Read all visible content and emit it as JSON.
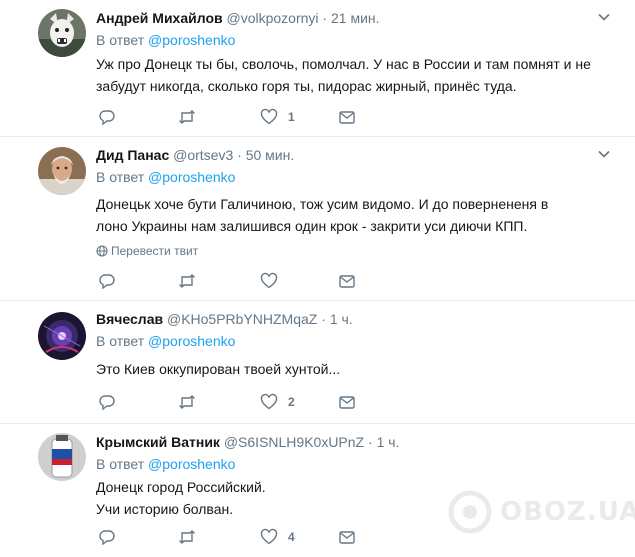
{
  "reply_prefix": "В ответ",
  "tweets": [
    {
      "name": "Андрей Михайлов",
      "handle": "@volkpozornyi",
      "separator": "·",
      "time": "21 мин.",
      "reply_to": "@poroshenko",
      "lines": [
        "Уж про Донецк ты бы, сволочь, помолчал. У нас в России и там помнят и не",
        "забудут никогда, сколько горя ты, пидорас жирный, принёс туда."
      ],
      "like_count": "1"
    },
    {
      "name": "Дид Панас",
      "handle": "@ortsev3",
      "separator": "·",
      "time": "50 мин.",
      "reply_to": "@poroshenko",
      "lines": [
        "Донецьк хоче бути Галичиною, тож усим видомо.  И до повернененя в",
        "лоно Украины нам залишився один крок - закрити уси диючи КПП."
      ],
      "translate": "Перевести твит",
      "like_count": ""
    },
    {
      "name": "Вячеслав",
      "handle": "@KHo5PRbYNHZMqaZ",
      "separator": "·",
      "time": "1 ч.",
      "reply_to": "@poroshenko",
      "lines": [
        "Это Киев оккупирован твоей хунтой..."
      ],
      "like_count": "2"
    },
    {
      "name": "Крымский Ватник",
      "handle": "@S6ISNLH9K0xUPnZ",
      "separator": "·",
      "time": "1 ч.",
      "reply_to": "@poroshenko",
      "lines": [
        "Донецк город Российский.",
        "Учи историю болван."
      ],
      "like_count": "4"
    }
  ],
  "watermark": "OBOZ.UA",
  "colors": {
    "link": "#1da1f2",
    "secondary": "#657786",
    "text": "#14171a",
    "divider": "#e6ecf0"
  }
}
